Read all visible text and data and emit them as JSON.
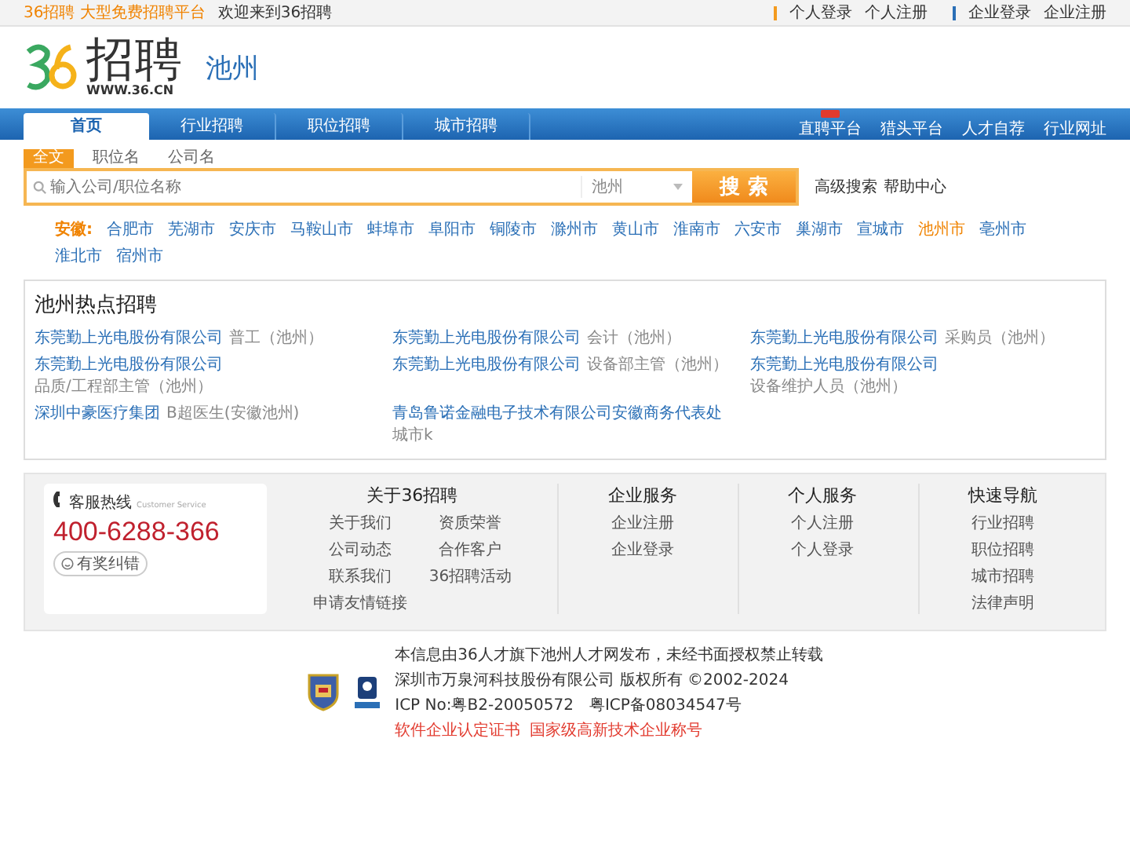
{
  "top_bar": {
    "slogan": "36招聘 大型免费招聘平台",
    "welcome": "欢迎来到36招聘",
    "personal_links": [
      "个人登录",
      "个人注册"
    ],
    "company_links": [
      "企业登录",
      "企业注册"
    ]
  },
  "header": {
    "logo_text": "招聘",
    "logo_url": "WWW.36.CN",
    "city": "池州"
  },
  "nav": {
    "items": [
      {
        "label": "首页",
        "selected": true
      },
      {
        "label": "行业招聘",
        "selected": false
      },
      {
        "label": "职位招聘",
        "selected": false
      },
      {
        "label": "城市招聘",
        "selected": false
      }
    ],
    "right_items": [
      {
        "label": "直聘平台",
        "badge": true
      },
      {
        "label": "猎头平台",
        "badge": false
      },
      {
        "label": "人才自荐",
        "badge": false
      },
      {
        "label": "行业网址",
        "badge": false
      }
    ]
  },
  "search": {
    "tabs": [
      {
        "label": "全文",
        "selected": true
      },
      {
        "label": "职位名",
        "selected": false
      },
      {
        "label": "公司名",
        "selected": false
      }
    ],
    "placeholder": "输入公司/职位名称",
    "city": "池州",
    "button": "搜 索",
    "links": [
      "高级搜索",
      "帮助中心"
    ]
  },
  "cities": {
    "province": "安徽:",
    "items": [
      {
        "label": "合肥市",
        "selected": false
      },
      {
        "label": "芜湖市",
        "selected": false
      },
      {
        "label": "安庆市",
        "selected": false
      },
      {
        "label": "马鞍山市",
        "selected": false
      },
      {
        "label": "蚌埠市",
        "selected": false
      },
      {
        "label": "阜阳市",
        "selected": false
      },
      {
        "label": "铜陵市",
        "selected": false
      },
      {
        "label": "滁州市",
        "selected": false
      },
      {
        "label": "黄山市",
        "selected": false
      },
      {
        "label": "淮南市",
        "selected": false
      },
      {
        "label": "六安市",
        "selected": false
      },
      {
        "label": "巢湖市",
        "selected": false
      },
      {
        "label": "宣城市",
        "selected": false
      },
      {
        "label": "池州市",
        "selected": true
      },
      {
        "label": "亳州市",
        "selected": false
      },
      {
        "label": "淮北市",
        "selected": false
      },
      {
        "label": "宿州市",
        "selected": false
      }
    ]
  },
  "hot_jobs": {
    "title": "池州热点招聘",
    "items": [
      {
        "company": "东莞勤上光电股份有限公司",
        "job": "普工（池州）"
      },
      {
        "company": "东莞勤上光电股份有限公司",
        "job": "会计（池州）"
      },
      {
        "company": "东莞勤上光电股份有限公司",
        "job": "采购员（池州）"
      },
      {
        "company": "东莞勤上光电股份有限公司",
        "job": "品质/工程部主管（池州）"
      },
      {
        "company": "东莞勤上光电股份有限公司",
        "job": "设备部主管（池州）"
      },
      {
        "company": "东莞勤上光电股份有限公司",
        "job": "设备维护人员（池州）"
      },
      {
        "company": "深圳中豪医疗集团",
        "job": "B超医生(安徽池州)"
      },
      {
        "company": "青岛鲁诺金融电子技术有限公司安徽商务代表处",
        "job": "城市k"
      }
    ]
  },
  "footer": {
    "hotline_label": "客服热线",
    "hotline_en": "Customer Service",
    "phone": "400-6288-366",
    "feedback": "有奖纠错",
    "columns": [
      {
        "title": "关于36招聘",
        "links": [
          "关于我们",
          "资质荣誉",
          "公司动态",
          "合作客户",
          "联系我们",
          "36招聘活动",
          "申请友情链接"
        ]
      },
      {
        "title": "企业服务",
        "links": [
          "企业注册",
          "企业登录"
        ]
      },
      {
        "title": "个人服务",
        "links": [
          "个人注册",
          "个人登录"
        ]
      },
      {
        "title": "快速导航",
        "links": [
          "行业招聘",
          "职位招聘",
          "城市招聘",
          "法律声明"
        ]
      }
    ]
  },
  "copyright": {
    "lines": [
      "本信息由36人才旗下池州人才网发布，未经书面授权禁止转载",
      "深圳市万泉河科技股份有限公司 版权所有 ©2002-2024",
      "ICP No:粤B2-20050572　粤ICP备08034547号"
    ],
    "links": [
      "软件企业认定证书",
      "国家级高新技术企业称号"
    ]
  }
}
